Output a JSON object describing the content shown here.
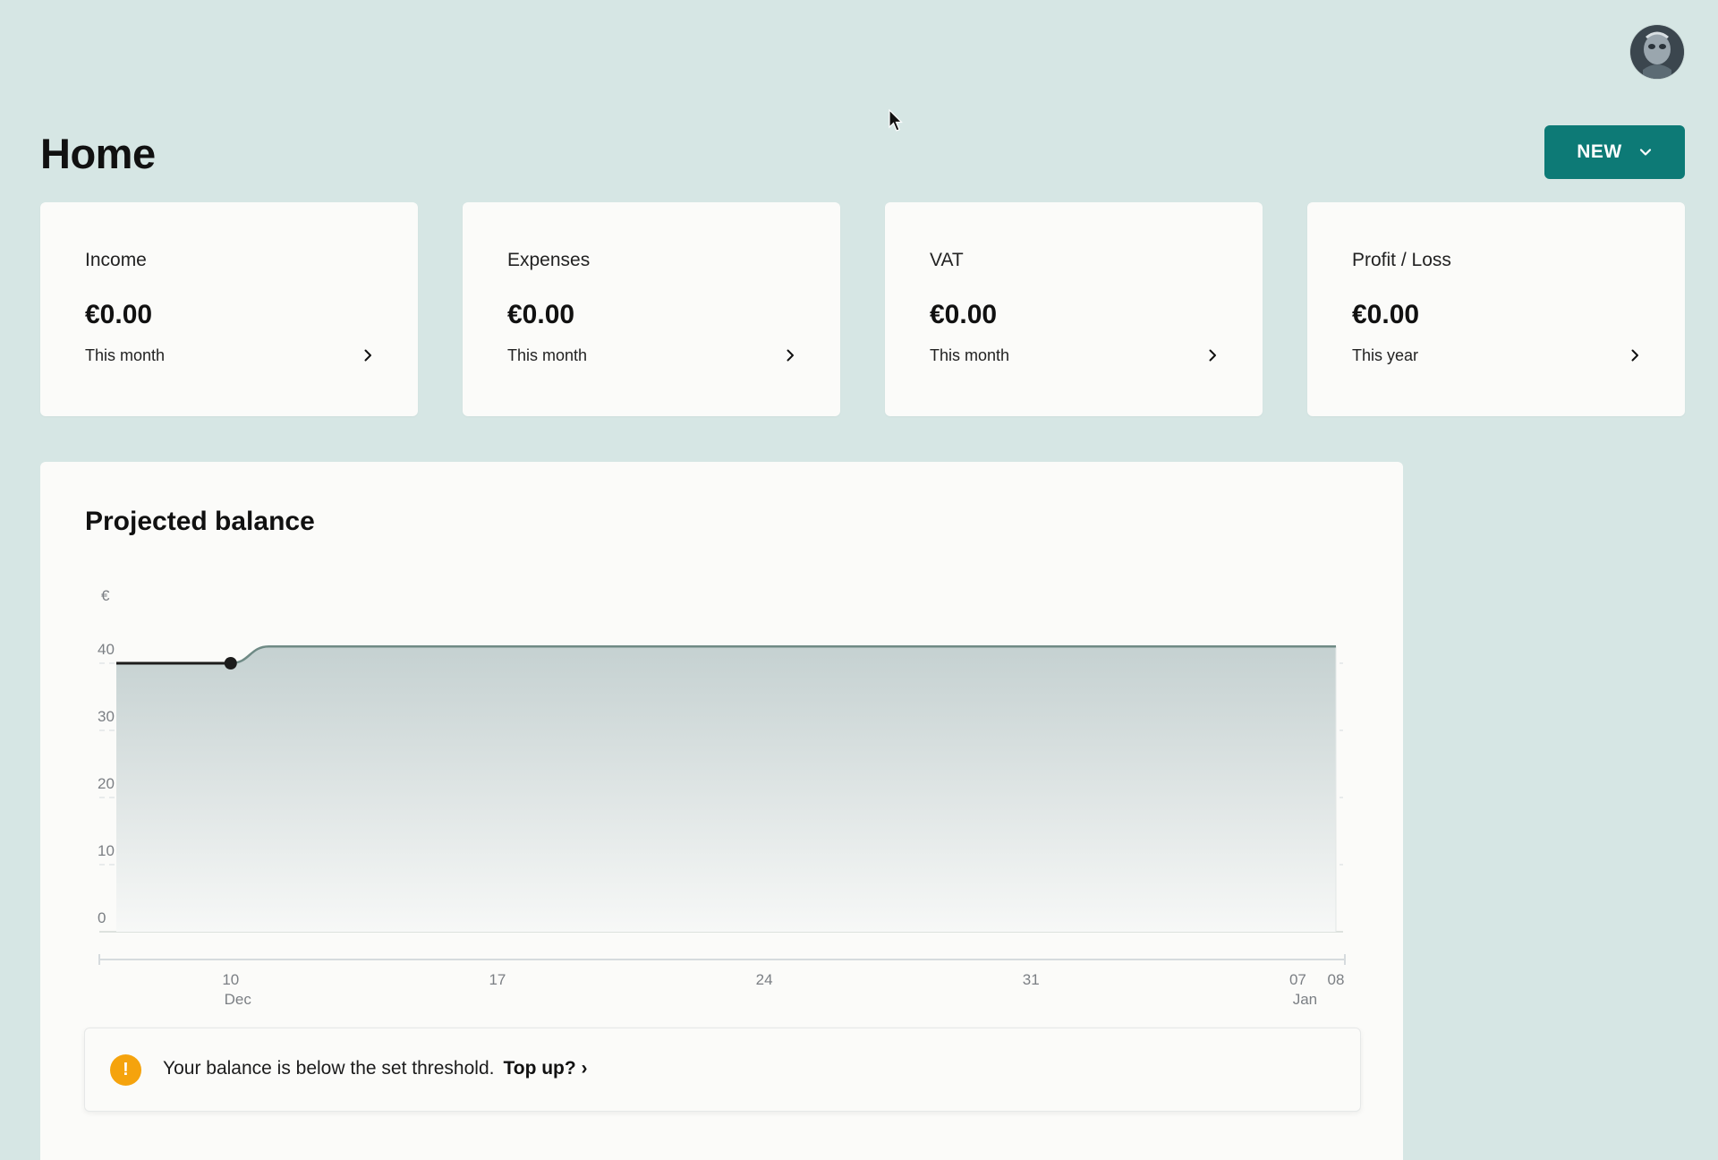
{
  "header": {
    "title": "Home",
    "new_button_label": "NEW",
    "avatar": "avatar-photo"
  },
  "cards": [
    {
      "label": "Income",
      "value": "€0.00",
      "period": "This month"
    },
    {
      "label": "Expenses",
      "value": "€0.00",
      "period": "This month"
    },
    {
      "label": "VAT",
      "value": "€0.00",
      "period": "This month"
    },
    {
      "label": "Profit / Loss",
      "value": "€0.00",
      "period": "This year"
    }
  ],
  "balance": {
    "title": "Projected balance",
    "alert_text": "Your balance is below the set threshold.",
    "alert_link": "Top up? ›",
    "alert_icon": "!"
  },
  "chart_data": {
    "type": "area",
    "title": "Projected balance",
    "ylabel": "€",
    "xlabel": "",
    "ylim": [
      0,
      40
    ],
    "yticks": [
      0,
      10,
      20,
      30,
      40
    ],
    "x_ticks": [
      {
        "day": 10,
        "label": "10",
        "sublabel": "Dec"
      },
      {
        "day": 17,
        "label": "17",
        "sublabel": ""
      },
      {
        "day": 24,
        "label": "24",
        "sublabel": ""
      },
      {
        "day": 31,
        "label": "31",
        "sublabel": ""
      },
      {
        "day": 38,
        "label": "07",
        "sublabel": "Jan"
      },
      {
        "day": 39,
        "label": "08",
        "sublabel": ""
      }
    ],
    "x_range": [
      7,
      39
    ],
    "actual": {
      "x": [
        7,
        10
      ],
      "y": [
        40,
        40
      ]
    },
    "projected": {
      "x": [
        10,
        11,
        39
      ],
      "y": [
        40,
        42.5,
        42.5
      ]
    },
    "grid": true,
    "colors": {
      "actual_line": "#1c1c1c",
      "projected_line": "#6f8a85",
      "fill_top": "#c5d1d1"
    }
  }
}
